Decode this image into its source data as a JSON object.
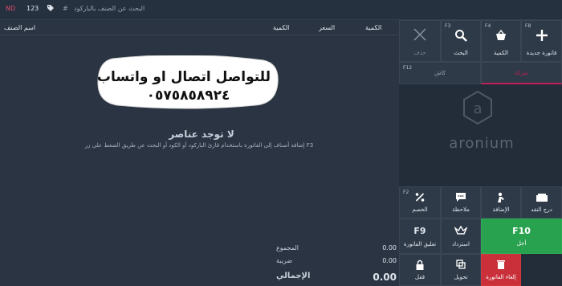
{
  "topbar": {
    "red_badge": "ND",
    "count": "123",
    "hash": "#",
    "search_placeholder": "البحث عن الصنف بالباركود"
  },
  "cart": {
    "columns": {
      "name": "اسم الصنف",
      "qty1": "الكمية",
      "price": "السعر",
      "qty2": "الكمية"
    },
    "empty_title": "لا توجد عناصر",
    "empty_sub": "F3 إضافة أصناف إلى الفاتورة باستخدام قارئ الباركود أو الكود أو البحث عن طريق الضغط على زر"
  },
  "overlay": {
    "line1": "للتواصل اتصال او واتساب",
    "line2": "٠٥٧٥٨٥٨٩٢٤"
  },
  "totals": {
    "subtotal_label": "المجموع",
    "subtotal_value": "0.00",
    "tax_label": "ضريبة",
    "tax_value": "0.00",
    "total_label": "الإجمالي",
    "total_value": "0.00"
  },
  "panel": {
    "tiles_top": [
      {
        "key": "F8",
        "label": "فاتورة جديدة",
        "icon": "plus-icon"
      },
      {
        "key": "F4",
        "label": "الكمية",
        "icon": "basket-icon"
      },
      {
        "key": "F3",
        "label": "البحث",
        "icon": "search-icon"
      },
      {
        "key": "",
        "label": "حذف",
        "icon": "close-icon"
      }
    ],
    "tiles_row2": [
      {
        "key": "",
        "label": "شركة",
        "icon": ""
      },
      {
        "key": "F12",
        "label": "كاش",
        "icon": ""
      }
    ],
    "tiles_mid": [
      {
        "key": "",
        "label": "درج النقد",
        "icon": "drawer-icon"
      },
      {
        "key": "",
        "label": "الإضافة",
        "icon": "person-icon"
      },
      {
        "key": "",
        "label": "ملاحظة",
        "icon": "comment-icon"
      },
      {
        "key": "F2",
        "label": "الخصم",
        "icon": "percent-icon"
      }
    ],
    "tiles_action": [
      {
        "key": "F10",
        "label": "أجل"
      },
      {
        "key": "",
        "label": "استرداد"
      },
      {
        "key": "F9",
        "label": "تعليق الفاتورة"
      }
    ],
    "tiles_bottom": [
      {
        "key": "",
        "label": "إلغاء الفاتورة"
      },
      {
        "key": "",
        "label": "تحويل"
      },
      {
        "key": "",
        "label": "قفل"
      }
    ],
    "logo_text": "aronium"
  },
  "colors": {
    "accent_green": "#28a24e",
    "accent_red": "#c9303a",
    "selected_tab": "#c01e56"
  }
}
